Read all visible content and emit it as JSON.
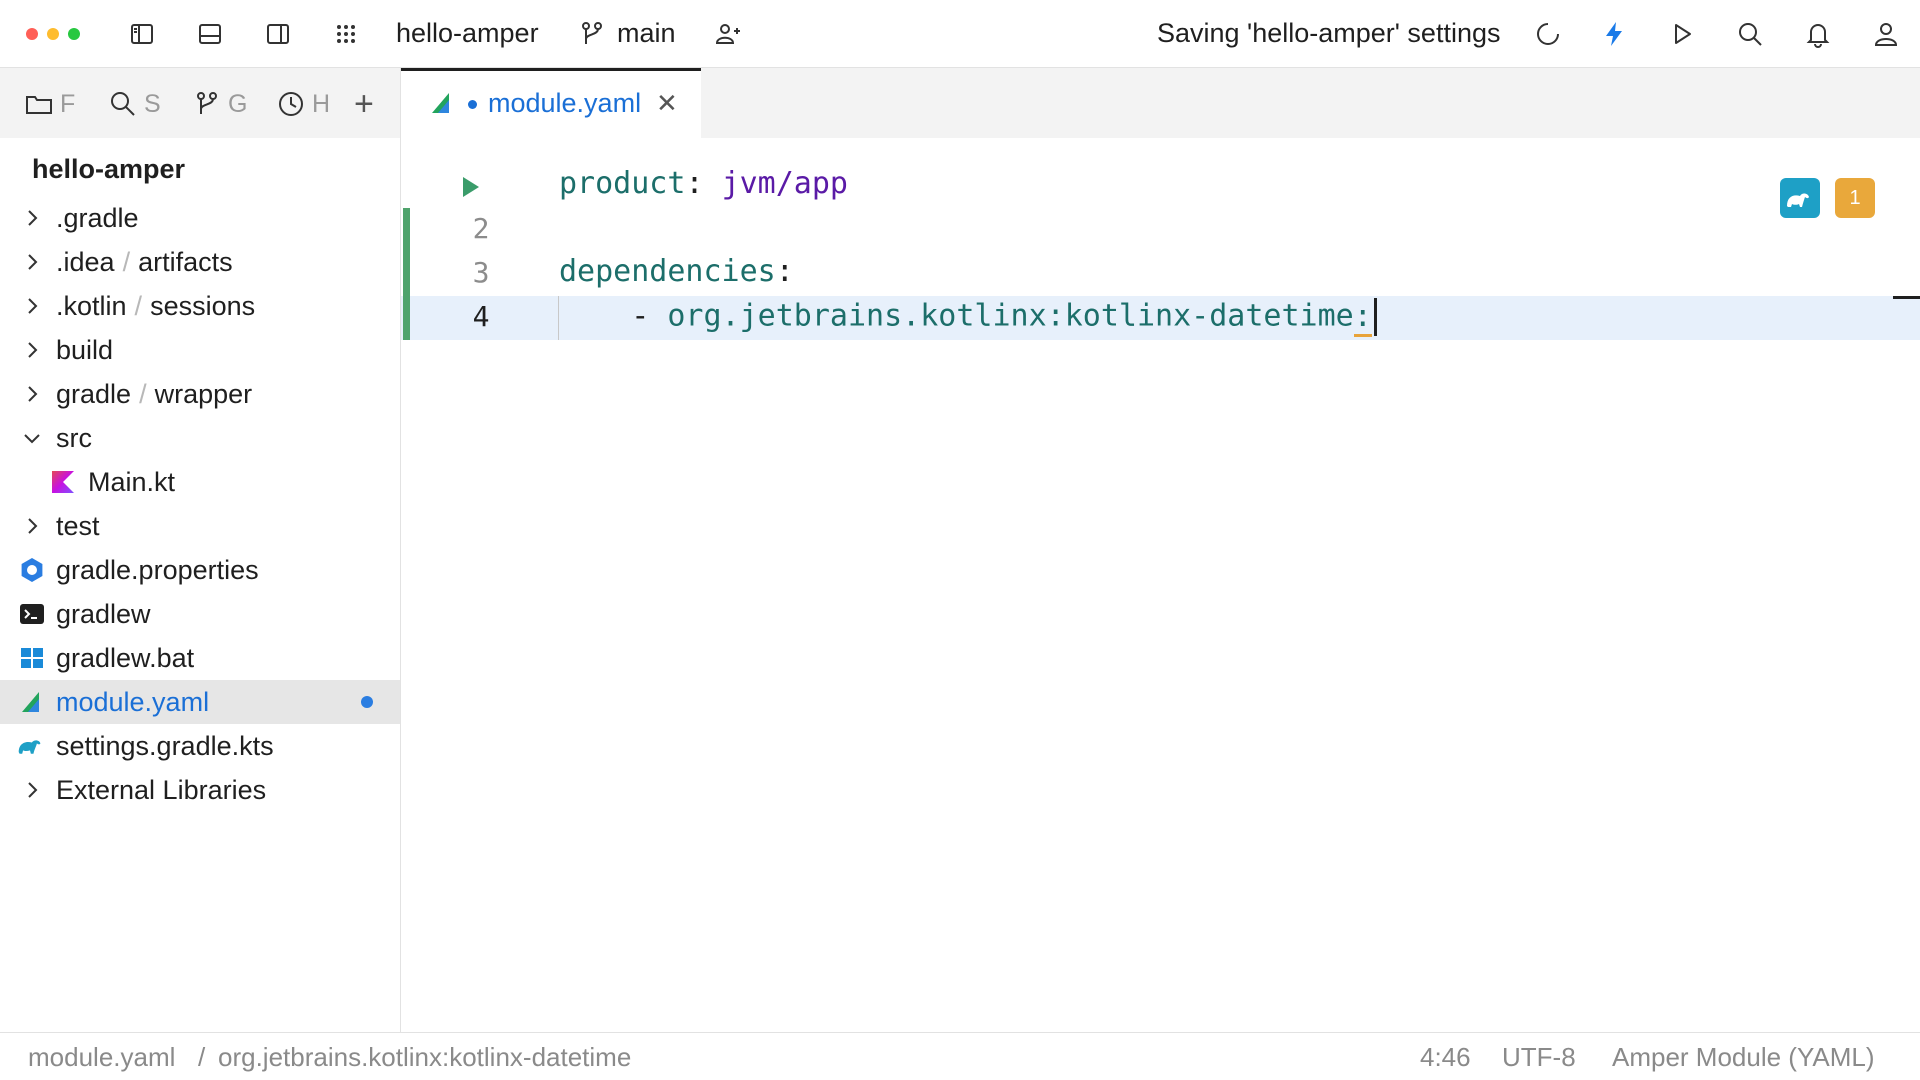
{
  "window": {
    "project_name": "hello-amper",
    "branch": "main",
    "status_message": "Saving 'hello-amper' settings",
    "icons": [
      "toggle-left-panel-icon",
      "toggle-bottom-panel-icon",
      "toggle-right-panel-icon",
      "apps-grid-icon",
      "branch-icon",
      "add-user-icon",
      "spinner-icon",
      "lightning-icon",
      "run-icon",
      "search-icon",
      "notifications-icon",
      "account-icon"
    ],
    "colors": {
      "close": "#ff5f57",
      "minimize": "#febc2e",
      "zoom": "#28c840",
      "accent": "#1a6fd6"
    }
  },
  "sidebar": {
    "tabs": [
      {
        "icon": "folder-icon",
        "label": "F"
      },
      {
        "icon": "search-icon",
        "label": "S"
      },
      {
        "icon": "git-icon",
        "label": "G"
      },
      {
        "icon": "history-icon",
        "label": "H"
      }
    ],
    "add_tab": "+",
    "project_title": "hello-amper",
    "tree": [
      {
        "label": ".gradle",
        "sub": "",
        "kind": "folder",
        "expanded": false
      },
      {
        "label": ".idea",
        "sub": "artifacts",
        "kind": "folder",
        "expanded": false
      },
      {
        "label": ".kotlin",
        "sub": "sessions",
        "kind": "folder",
        "expanded": false
      },
      {
        "label": "build",
        "sub": "",
        "kind": "folder",
        "expanded": false
      },
      {
        "label": "gradle",
        "sub": "wrapper",
        "kind": "folder",
        "expanded": false
      },
      {
        "label": "src",
        "sub": "",
        "kind": "folder",
        "expanded": true
      },
      {
        "label": "Main.kt",
        "sub": "",
        "kind": "kotlin-file"
      },
      {
        "label": "test",
        "sub": "",
        "kind": "folder",
        "expanded": false
      },
      {
        "label": "gradle.properties",
        "sub": "",
        "kind": "properties-file"
      },
      {
        "label": "gradlew",
        "sub": "",
        "kind": "terminal-file"
      },
      {
        "label": "gradlew.bat",
        "sub": "",
        "kind": "windows-file"
      },
      {
        "label": "module.yaml",
        "sub": "",
        "kind": "amper-file",
        "selected": true,
        "modified": true
      },
      {
        "label": "settings.gradle.kts",
        "sub": "",
        "kind": "gradle-file"
      },
      {
        "label": "External Libraries",
        "sub": "",
        "kind": "folder",
        "expanded": false
      }
    ]
  },
  "editor": {
    "tab_label": "module.yaml",
    "line_numbers": [
      "2",
      "3",
      "4"
    ],
    "lines": [
      {
        "key": "product",
        "colon": ":",
        "value": "jvm/app"
      },
      {
        "key": "",
        "colon": "",
        "value": ""
      },
      {
        "key": "dependencies",
        "colon": ":",
        "value": ""
      },
      {
        "dash": "- ",
        "value": "org.jetbrains.kotlinx:kotlinx-datetime",
        "colon": ":"
      }
    ],
    "problems_count": "1"
  },
  "statusbar": {
    "breadcrumb_file": "module.yaml",
    "breadcrumb_sep": "/",
    "breadcrumb_item": "org.jetbrains.kotlinx:kotlinx-datetime",
    "position": "4:46",
    "encoding": "UTF-8",
    "file_type": "Amper Module (YAML)"
  }
}
